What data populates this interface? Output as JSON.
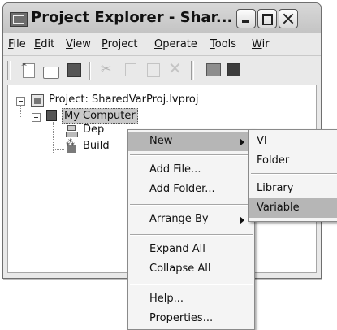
{
  "window": {
    "title": "Project Explorer - Shar..."
  },
  "menubar": {
    "items": [
      "File",
      "Edit",
      "View",
      "Project",
      "Operate",
      "Tools",
      "Wir"
    ]
  },
  "toolbar": {
    "icons": [
      "new-icon",
      "open-icon",
      "save-all-icon",
      "cut-icon",
      "copy-icon",
      "paste-icon",
      "delete-icon",
      "build-icon",
      "deploy-icon"
    ]
  },
  "tree": {
    "project": "Project: SharedVarProj.lvproj",
    "computer": "My Computer",
    "dependencies": "Dep",
    "build": "Build"
  },
  "context_menu": {
    "items": [
      "New",
      "Add File...",
      "Add Folder...",
      "Arrange By",
      "Expand All",
      "Collapse All",
      "Help...",
      "Properties..."
    ]
  },
  "submenu": {
    "items": [
      "VI",
      "Folder",
      "Library",
      "Variable"
    ]
  }
}
